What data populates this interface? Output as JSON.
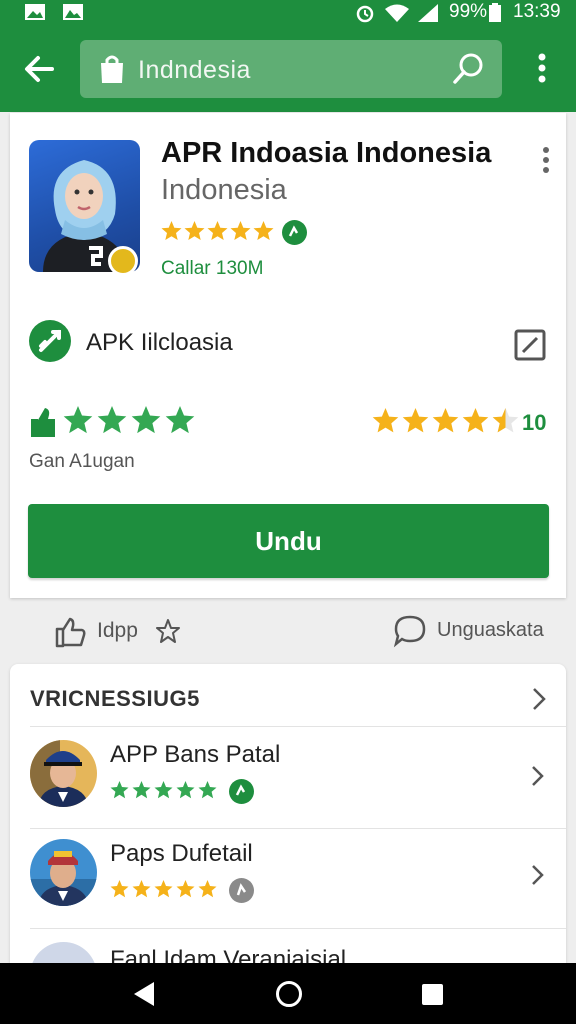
{
  "status_bar": {
    "battery": "99%",
    "time": "13:39"
  },
  "search": {
    "query": "Indndesia"
  },
  "app": {
    "title": "APR Indoasia Indonesia",
    "subtitle": "Indonesia",
    "rating_stars": 5,
    "downloads_label": "Callar 130M",
    "apk_label": "APK Iilcloasia",
    "rating_caption": "Gan A1ugan",
    "rating_right_stars": 4.5,
    "rating_count": "10",
    "install_label": "Undu"
  },
  "actions": {
    "like_label": "Idpp",
    "review_label": "Unguaskata"
  },
  "similar": {
    "header": "VRICNESSIUG5",
    "items": [
      {
        "name": "APP Bans Patal",
        "stars": 5,
        "badge_color": "#1e8e3e"
      },
      {
        "name": "Paps Dufetail",
        "stars": 5,
        "badge_color": "#8a8a8a"
      }
    ],
    "partial_item": "Fanl Idam Veraniaisial"
  },
  "colors": {
    "brand_green": "#1e8e3e",
    "star_gold": "#f5b21a",
    "star_green": "#34a853"
  },
  "icons": [
    "back-arrow-icon",
    "shopping-bag-icon",
    "search-icon",
    "more-vert-icon",
    "edit-external-icon",
    "thumb-up-icon",
    "star-outline-icon",
    "review-bubble-icon",
    "chevron-right-icon",
    "nav-back-icon",
    "nav-home-icon",
    "nav-recent-icon"
  ]
}
